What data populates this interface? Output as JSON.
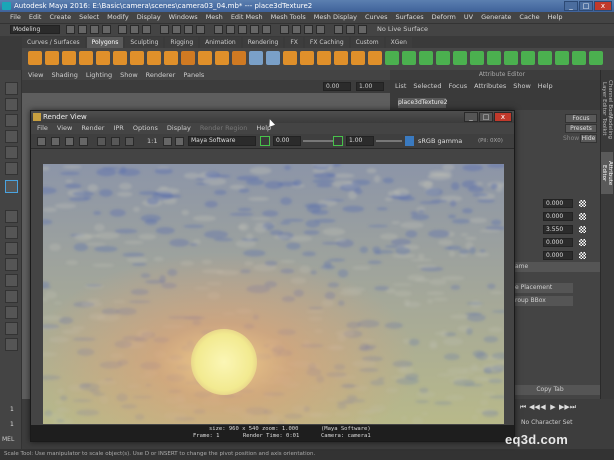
{
  "window": {
    "title": "Autodesk Maya 2016: E:\\Basic\\camera\\scenes\\camera03_04.mb* --- place3dTexture2",
    "buttons": [
      "_",
      "□",
      "x"
    ]
  },
  "main_menu": [
    "File",
    "Edit",
    "Create",
    "Select",
    "Modify",
    "Display",
    "Windows",
    "Mesh",
    "Edit Mesh",
    "Mesh Tools",
    "Mesh Display",
    "Curves",
    "Surfaces",
    "Deform",
    "UV",
    "Generate",
    "Cache",
    "Help"
  ],
  "status_line": {
    "mode": "Modeling",
    "live_surface": "No Live Surface"
  },
  "shelf_tabs": [
    {
      "label": "Curves / Surfaces",
      "active": false
    },
    {
      "label": "Polygons",
      "active": true
    },
    {
      "label": "Sculpting",
      "active": false
    },
    {
      "label": "Rigging",
      "active": false
    },
    {
      "label": "Animation",
      "active": false
    },
    {
      "label": "Rendering",
      "active": false
    },
    {
      "label": "FX",
      "active": false
    },
    {
      "label": "FX Caching",
      "active": false
    },
    {
      "label": "Custom",
      "active": false
    },
    {
      "label": "XGen",
      "active": false
    }
  ],
  "panel_menu": [
    "View",
    "Shading",
    "Lighting",
    "Show",
    "Renderer",
    "Panels"
  ],
  "panel_values": [
    "0.00",
    "1.00"
  ],
  "attribute_editor": {
    "header": "Attribute Editor",
    "menu": [
      "List",
      "Selected",
      "Focus",
      "Attributes",
      "Show",
      "Help"
    ],
    "node_tab": "place3dTexture2",
    "buttons": [
      "Focus",
      "Presets",
      "Hide"
    ],
    "show_label": "Show",
    "fields": [
      "0.000",
      "0.000",
      "3.550",
      "0.000",
      "0.000"
    ],
    "rows": [
      "ame",
      "e Placement",
      "roup BBox"
    ],
    "copy_tab": "Copy Tab"
  },
  "side_tabs": [
    {
      "label": "Channel Box / Layer Editor",
      "active": false
    },
    {
      "label": "Modeling Toolkit",
      "active": false
    },
    {
      "label": "Attribute Editor",
      "active": true
    }
  ],
  "time": {
    "current_frame": "1",
    "start_frame": "1",
    "character_set": "No Character Set"
  },
  "playback_icons": [
    "⏮",
    "◀◀",
    "◀",
    "▶",
    "▶▶",
    "⏭"
  ],
  "command_line": {
    "label": "MEL",
    "help_text": "Scale Tool: Use manipulator to scale object(s). Use D or INSERT to change the pivot position and axis orientation."
  },
  "render_view": {
    "title": "Render View",
    "menu": [
      {
        "label": "File",
        "disabled": false
      },
      {
        "label": "View",
        "disabled": false
      },
      {
        "label": "Render",
        "disabled": false
      },
      {
        "label": "IPR",
        "disabled": false
      },
      {
        "label": "Options",
        "disabled": false
      },
      {
        "label": "Display",
        "disabled": false
      },
      {
        "label": "Render Region",
        "disabled": true
      },
      {
        "label": "Help",
        "disabled": false
      }
    ],
    "ratio_label": "1:1",
    "renderer": "Maya Software",
    "exposure": "0.00",
    "gamma": "1.00",
    "color_space": "sRGB gamma",
    "pixel_value": "(Pil: 0X0)",
    "info": {
      "size": "size: 960 x 540  zoom: 1.000",
      "renderer": "(Maya Software)",
      "frame": "Frame: 1",
      "render_time": "Render Time: 0:01",
      "camera": "Camera: camera1"
    }
  },
  "watermark": "eq3d.com",
  "colors": {
    "sky_top": "#8c95a8",
    "sky_bottom": "#b8b98a",
    "sun": "#f7f2a0",
    "sun_glow": "#e8a070",
    "accent_green": "#47c24a",
    "title_blue": "#4a6fa5"
  }
}
